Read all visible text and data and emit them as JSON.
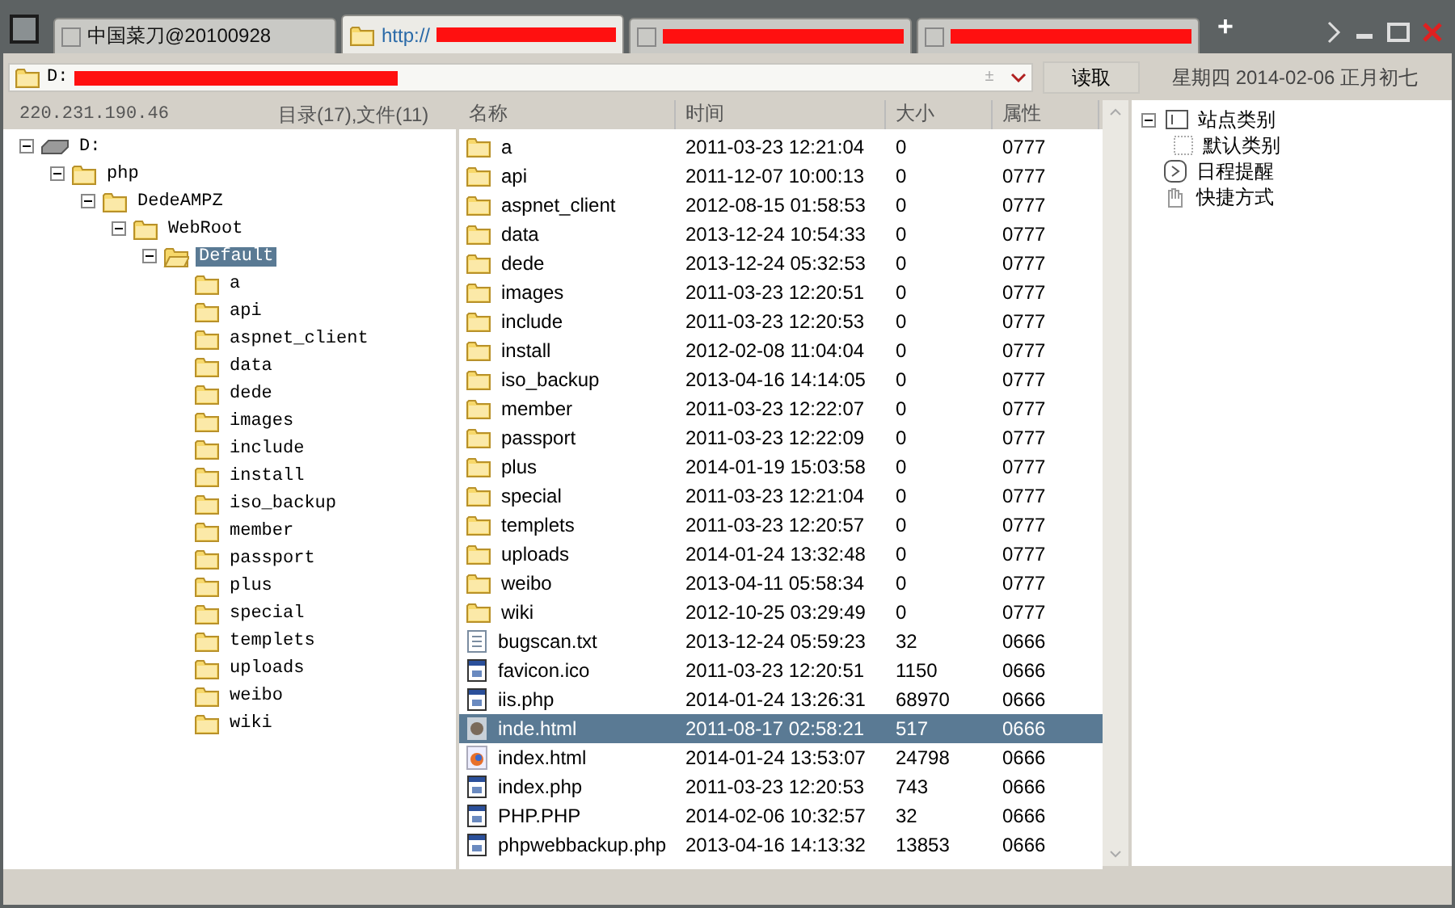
{
  "tabs": [
    {
      "kind": "app",
      "label": "中国菜刀@20100928",
      "selected": false
    },
    {
      "kind": "url",
      "label": "http://",
      "selected": true
    },
    {
      "kind": "redacted",
      "selected": false
    },
    {
      "kind": "redacted",
      "selected": false
    }
  ],
  "new_tab": "+",
  "address": {
    "path": "D:",
    "toggle_mark": "±",
    "read_button": "读取",
    "date": "星期四 2014-02-06 正月初七"
  },
  "info": {
    "ip": "220.231.190.46",
    "counts": "目录(17),文件(11)"
  },
  "tree": [
    {
      "label": "D:",
      "kind": "drive",
      "expanded": true,
      "selected": false,
      "children": [
        {
          "label": "php",
          "kind": "folder",
          "expanded": true,
          "selected": false,
          "children": [
            {
              "label": "DedeAMPZ",
              "kind": "folder",
              "expanded": true,
              "selected": false,
              "children": [
                {
                  "label": "WebRoot",
                  "kind": "folder",
                  "expanded": true,
                  "selected": false,
                  "children": [
                    {
                      "label": "Default",
                      "kind": "open-folder",
                      "expanded": true,
                      "selected": true,
                      "children": [
                        {
                          "label": "a",
                          "kind": "folder",
                          "selected": false
                        },
                        {
                          "label": "api",
                          "kind": "folder",
                          "selected": false
                        },
                        {
                          "label": "aspnet_client",
                          "kind": "folder",
                          "selected": false
                        },
                        {
                          "label": "data",
                          "kind": "folder",
                          "selected": false
                        },
                        {
                          "label": "dede",
                          "kind": "folder",
                          "selected": false
                        },
                        {
                          "label": "images",
                          "kind": "folder",
                          "selected": false
                        },
                        {
                          "label": "include",
                          "kind": "folder",
                          "selected": false
                        },
                        {
                          "label": "install",
                          "kind": "folder",
                          "selected": false
                        },
                        {
                          "label": "iso_backup",
                          "kind": "folder",
                          "selected": false
                        },
                        {
                          "label": "member",
                          "kind": "folder",
                          "selected": false
                        },
                        {
                          "label": "passport",
                          "kind": "folder",
                          "selected": false
                        },
                        {
                          "label": "plus",
                          "kind": "folder",
                          "selected": false
                        },
                        {
                          "label": "special",
                          "kind": "folder",
                          "selected": false
                        },
                        {
                          "label": "templets",
                          "kind": "folder",
                          "selected": false
                        },
                        {
                          "label": "uploads",
                          "kind": "folder",
                          "selected": false
                        },
                        {
                          "label": "weibo",
                          "kind": "folder",
                          "selected": false
                        },
                        {
                          "label": "wiki",
                          "kind": "folder",
                          "selected": false
                        }
                      ]
                    }
                  ]
                }
              ]
            }
          ]
        }
      ]
    }
  ],
  "files": {
    "columns": [
      "名称",
      "时间",
      "大小",
      "属性"
    ],
    "rows": [
      {
        "kind": "folder",
        "name": "a",
        "time": "2011-03-23 12:21:04",
        "size": "0",
        "attr": "0777",
        "selected": false
      },
      {
        "kind": "folder",
        "name": "api",
        "time": "2011-12-07 10:00:13",
        "size": "0",
        "attr": "0777",
        "selected": false
      },
      {
        "kind": "folder",
        "name": "aspnet_client",
        "time": "2012-08-15 01:58:53",
        "size": "0",
        "attr": "0777",
        "selected": false
      },
      {
        "kind": "folder",
        "name": "data",
        "time": "2013-12-24 10:54:33",
        "size": "0",
        "attr": "0777",
        "selected": false
      },
      {
        "kind": "folder",
        "name": "dede",
        "time": "2013-12-24 05:32:53",
        "size": "0",
        "attr": "0777",
        "selected": false
      },
      {
        "kind": "folder",
        "name": "images",
        "time": "2011-03-23 12:20:51",
        "size": "0",
        "attr": "0777",
        "selected": false
      },
      {
        "kind": "folder",
        "name": "include",
        "time": "2011-03-23 12:20:53",
        "size": "0",
        "attr": "0777",
        "selected": false
      },
      {
        "kind": "folder",
        "name": "install",
        "time": "2012-02-08 11:04:04",
        "size": "0",
        "attr": "0777",
        "selected": false
      },
      {
        "kind": "folder",
        "name": "iso_backup",
        "time": "2013-04-16 14:14:05",
        "size": "0",
        "attr": "0777",
        "selected": false
      },
      {
        "kind": "folder",
        "name": "member",
        "time": "2011-03-23 12:22:07",
        "size": "0",
        "attr": "0777",
        "selected": false
      },
      {
        "kind": "folder",
        "name": "passport",
        "time": "2011-03-23 12:22:09",
        "size": "0",
        "attr": "0777",
        "selected": false
      },
      {
        "kind": "folder",
        "name": "plus",
        "time": "2014-01-19 15:03:58",
        "size": "0",
        "attr": "0777",
        "selected": false
      },
      {
        "kind": "folder",
        "name": "special",
        "time": "2011-03-23 12:21:04",
        "size": "0",
        "attr": "0777",
        "selected": false
      },
      {
        "kind": "folder",
        "name": "templets",
        "time": "2011-03-23 12:20:57",
        "size": "0",
        "attr": "0777",
        "selected": false
      },
      {
        "kind": "folder",
        "name": "uploads",
        "time": "2014-01-24 13:32:48",
        "size": "0",
        "attr": "0777",
        "selected": false
      },
      {
        "kind": "folder",
        "name": "weibo",
        "time": "2013-04-11 05:58:34",
        "size": "0",
        "attr": "0777",
        "selected": false
      },
      {
        "kind": "folder",
        "name": "wiki",
        "time": "2012-10-25 03:29:49",
        "size": "0",
        "attr": "0777",
        "selected": false
      },
      {
        "kind": "text",
        "name": "bugscan.txt",
        "time": "2013-12-24 05:59:23",
        "size": "32",
        "attr": "0666",
        "selected": false
      },
      {
        "kind": "app",
        "name": "favicon.ico",
        "time": "2011-03-23 12:20:51",
        "size": "1150",
        "attr": "0666",
        "selected": false
      },
      {
        "kind": "app",
        "name": "iis.php",
        "time": "2014-01-24 13:26:31",
        "size": "68970",
        "attr": "0666",
        "selected": false
      },
      {
        "kind": "web",
        "name": "inde.html",
        "time": "2011-08-17 02:58:21",
        "size": "517",
        "attr": "0666",
        "selected": true
      },
      {
        "kind": "browser",
        "name": "index.html",
        "time": "2014-01-24 13:53:07",
        "size": "24798",
        "attr": "0666",
        "selected": false
      },
      {
        "kind": "app",
        "name": "index.php",
        "time": "2011-03-23 12:20:53",
        "size": "743",
        "attr": "0666",
        "selected": false
      },
      {
        "kind": "app",
        "name": "PHP.PHP",
        "time": "2014-02-06 10:32:57",
        "size": "32",
        "attr": "0666",
        "selected": false
      },
      {
        "kind": "app",
        "name": "phpwebbackup.php",
        "time": "2013-04-16 14:13:32",
        "size": "13853",
        "attr": "0666",
        "selected": false
      }
    ]
  },
  "side": [
    {
      "kind": "category",
      "label": "站点类别",
      "expanded": true,
      "children": [
        {
          "kind": "category-item",
          "label": "默认类别"
        }
      ]
    },
    {
      "kind": "reminder",
      "label": "日程提醒"
    },
    {
      "kind": "shortcut",
      "label": "快捷方式"
    }
  ]
}
